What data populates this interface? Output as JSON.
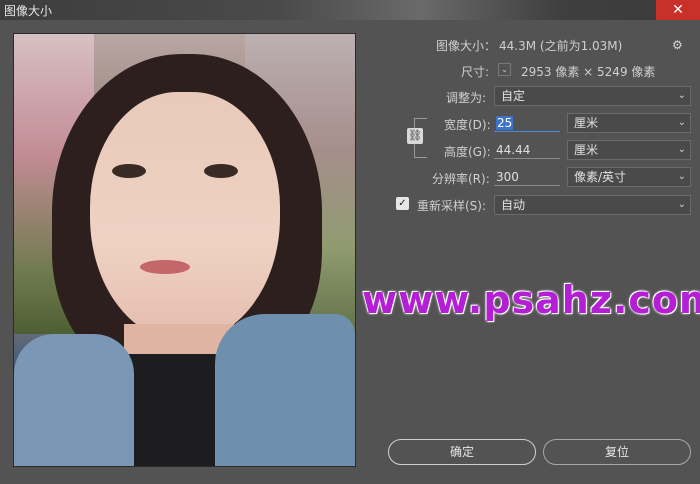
{
  "window": {
    "title": "图像大小",
    "close_symbol": "✕"
  },
  "info": {
    "image_size_label": "图像大小：",
    "image_size_value": "44.3M (之前为1.03M)",
    "dimensions_label": "尺寸:",
    "dimensions_value": "2953 像素 × 5249 像素"
  },
  "fit_to": {
    "label": "调整为:",
    "value": "自定"
  },
  "width": {
    "label": "宽度(D):",
    "value": "25",
    "unit": "厘米"
  },
  "height": {
    "label": "高度(G):",
    "value": "44.44",
    "unit": "厘米"
  },
  "resolution": {
    "label": "分辨率(R):",
    "value": "300",
    "unit": "像素/英寸"
  },
  "resample": {
    "label": "重新采样(S):",
    "value": "自动",
    "checked": true
  },
  "watermark": "www.psahz.com",
  "buttons": {
    "ok": "确定",
    "reset": "复位"
  },
  "icons": {
    "gear": "gear-icon",
    "link": "chain-link-icon",
    "chevron": "chevron-down-icon"
  }
}
